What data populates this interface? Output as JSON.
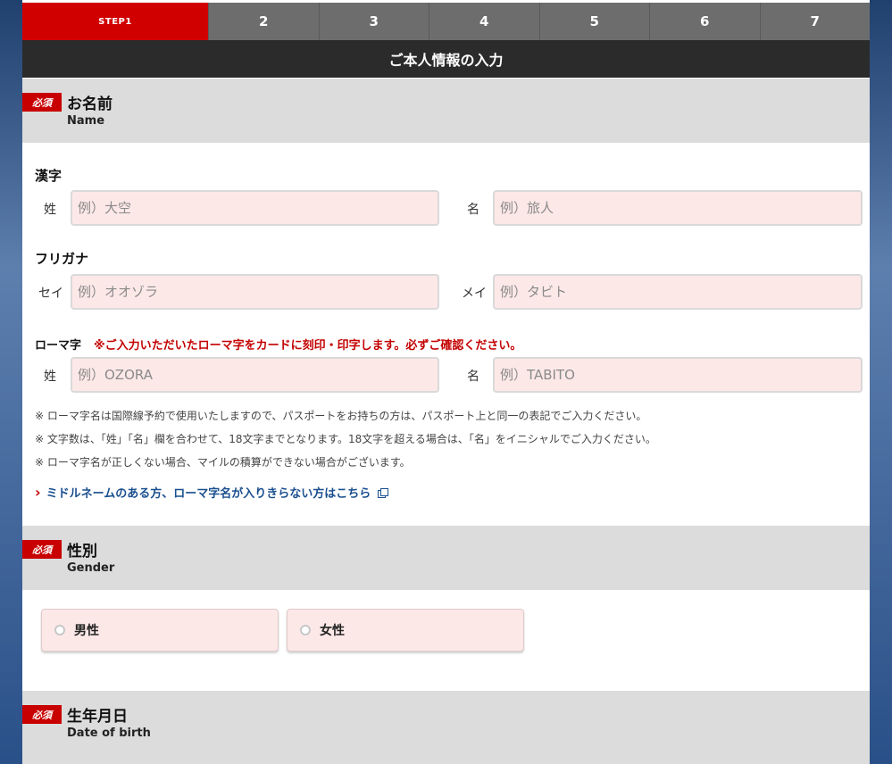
{
  "steps": [
    "STEP1",
    "2",
    "3",
    "4",
    "5",
    "6",
    "7"
  ],
  "page_title": "ご本人情報の入力",
  "required_badge": "必須",
  "name_section": {
    "title": "お名前",
    "sub": "Name"
  },
  "kanji": {
    "label": "漢字",
    "last_label": "姓",
    "last_placeholder": "例）大空",
    "first_label": "名",
    "first_placeholder": "例）旅人"
  },
  "furigana": {
    "label": "フリガナ",
    "last_label": "セイ",
    "last_placeholder": "例）オオゾラ",
    "first_label": "メイ",
    "first_placeholder": "例）タビト"
  },
  "roman": {
    "label": "ローマ字",
    "warning": "※ご入力いただいたローマ字をカードに刻印・印字します。必ずご確認ください。",
    "last_label": "姓",
    "last_placeholder": "例）OZORA",
    "first_label": "名",
    "first_placeholder": "例）TABITO"
  },
  "notes": [
    "※ ローマ字名は国際線予約で使用いたしますので、パスポートをお持ちの方は、パスポート上と同一の表記でご入力ください。",
    "※ 文字数は、「姓」「名」欄を合わせて、18文字までとなります。18文字を超える場合は、「名」をイニシャルでご入力ください。",
    "※ ローマ字名が正しくない場合、マイルの積算ができない場合がございます。"
  ],
  "middle_name_link": "ミドルネームのある方、ローマ字名が入りきらない方はこちら",
  "gender_section": {
    "title": "性別",
    "sub": "Gender"
  },
  "gender_options": [
    "男性",
    "女性"
  ],
  "birth_section": {
    "title": "生年月日",
    "sub": "Date of birth"
  },
  "colors": {
    "accent": "#d10000",
    "input_bg": "#fde8e8",
    "header_bg": "#dcdcdc",
    "link": "#1a4f8f"
  },
  "icons": {
    "link_chevron": "chevron-right-icon",
    "external": "external-link-icon",
    "radio": "radio-circle-icon"
  }
}
